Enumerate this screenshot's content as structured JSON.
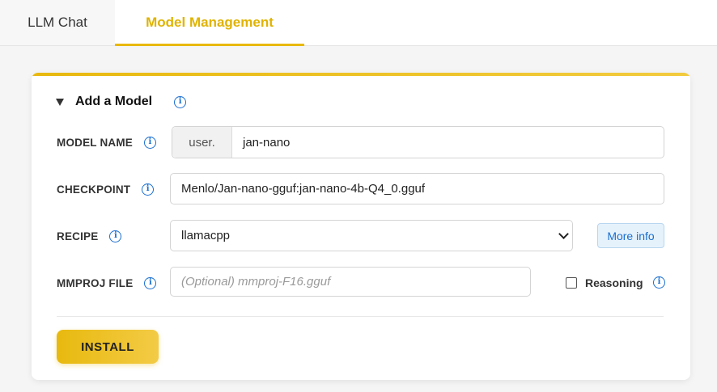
{
  "tabs": [
    {
      "label": "LLM Chat"
    },
    {
      "label": "Model Management"
    }
  ],
  "section": {
    "title": "Add a Model",
    "info_icon": "info-icon"
  },
  "form": {
    "model_name": {
      "label": "MODEL NAME",
      "prefix": "user.",
      "value": "jan-nano"
    },
    "checkpoint": {
      "label": "CHECKPOINT",
      "value": "Menlo/Jan-nano-gguf:jan-nano-4b-Q4_0.gguf"
    },
    "recipe": {
      "label": "RECIPE",
      "selected": "llamacpp",
      "more_info_label": "More info"
    },
    "mmproj": {
      "label": "MMPROJ FILE",
      "placeholder": "(Optional) mmproj-F16.gguf"
    },
    "reasoning": {
      "label": "Reasoning",
      "checked": false
    }
  },
  "install_label": "INSTALL",
  "colors": {
    "accent": "#e8b90f",
    "info": "#1a6fd0"
  }
}
